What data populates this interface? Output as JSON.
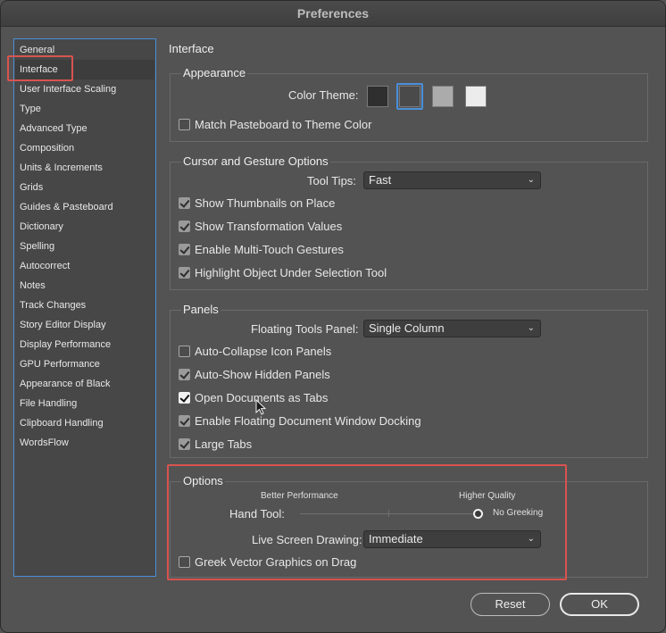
{
  "window": {
    "title": "Preferences"
  },
  "sidebar": {
    "items": [
      {
        "label": "General"
      },
      {
        "label": "Interface",
        "selected": true
      },
      {
        "label": "User Interface Scaling"
      },
      {
        "label": "Type"
      },
      {
        "label": "Advanced Type"
      },
      {
        "label": "Composition"
      },
      {
        "label": "Units & Increments"
      },
      {
        "label": "Grids"
      },
      {
        "label": "Guides & Pasteboard"
      },
      {
        "label": "Dictionary"
      },
      {
        "label": "Spelling"
      },
      {
        "label": "Autocorrect"
      },
      {
        "label": "Notes"
      },
      {
        "label": "Track Changes"
      },
      {
        "label": "Story Editor Display"
      },
      {
        "label": "Display Performance"
      },
      {
        "label": "GPU Performance"
      },
      {
        "label": "Appearance of Black"
      },
      {
        "label": "File Handling"
      },
      {
        "label": "Clipboard Handling"
      },
      {
        "label": "WordsFlow"
      }
    ]
  },
  "main": {
    "title": "Interface"
  },
  "appearance": {
    "title": "Appearance",
    "color_theme_label": "Color Theme:",
    "themes": [
      {
        "name": "dark",
        "color": "#2f2f2f"
      },
      {
        "name": "medium-dark",
        "color": "#4a4a4a",
        "selected": true
      },
      {
        "name": "medium-light",
        "color": "#ababab"
      },
      {
        "name": "light",
        "color": "#ececec"
      }
    ],
    "match_pasteboard": {
      "label": "Match Pasteboard to Theme Color",
      "checked": false
    }
  },
  "cursor_gesture": {
    "title": "Cursor and Gesture Options",
    "tool_tips_label": "Tool Tips:",
    "tool_tips_value": "Fast",
    "options": [
      {
        "label": "Show Thumbnails on Place",
        "checked": true
      },
      {
        "label": "Show Transformation Values",
        "checked": true
      },
      {
        "label": "Enable Multi-Touch Gestures",
        "checked": true
      },
      {
        "label": "Highlight Object Under Selection Tool",
        "checked": true
      }
    ]
  },
  "panels": {
    "title": "Panels",
    "floating_tools_label": "Floating Tools Panel:",
    "floating_tools_value": "Single Column",
    "options": [
      {
        "label": "Auto-Collapse Icon Panels",
        "checked": false
      },
      {
        "label": "Auto-Show Hidden Panels",
        "checked": true
      },
      {
        "label": "Open Documents as Tabs",
        "checked": true
      },
      {
        "label": "Enable Floating Document Window Docking",
        "checked": true
      },
      {
        "label": "Large Tabs",
        "checked": true
      }
    ]
  },
  "options": {
    "title": "Options",
    "better_performance_label": "Better Performance",
    "higher_quality_label": "Higher Quality",
    "hand_tool_label": "Hand Tool:",
    "hand_tool_value_label": "No Greeking",
    "hand_tool_level": 1.0,
    "live_screen_label": "Live Screen Drawing:",
    "live_screen_value": "Immediate",
    "greek_vector": {
      "label": "Greek Vector Graphics on Drag",
      "checked": false
    }
  },
  "buttons": {
    "reset": "Reset",
    "ok": "OK"
  },
  "colors": {
    "highlight": "#d9534f",
    "accent": "#4a90d9"
  }
}
